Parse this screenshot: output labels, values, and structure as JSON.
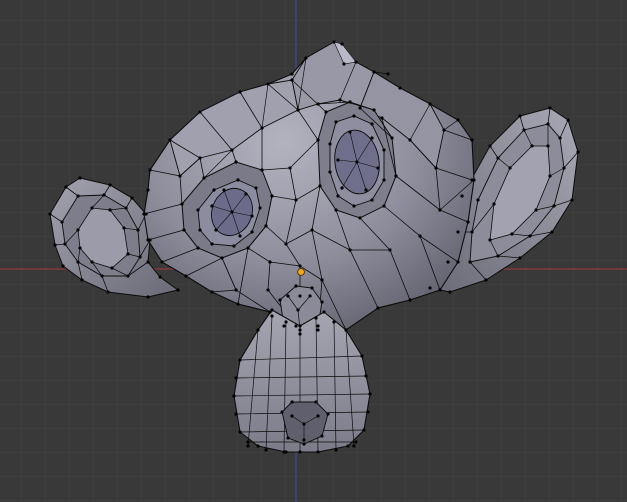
{
  "viewport": {
    "mode": "edit-mode-wireframe",
    "object": "monkey-mesh",
    "colors": {
      "background": "#393939",
      "grid_minor": "#434343",
      "grid_major": "#4a4a4a",
      "x_axis": "#8e3a3a",
      "y_axis": "#3a4a9a",
      "mesh_fill_light": "#a9a9b6",
      "mesh_fill_mid": "#8d8d9c",
      "mesh_fill_dark": "#6e6e7c",
      "edge": "#0c0c0c",
      "vertex": "#000000",
      "origin": "#f5a623"
    }
  }
}
